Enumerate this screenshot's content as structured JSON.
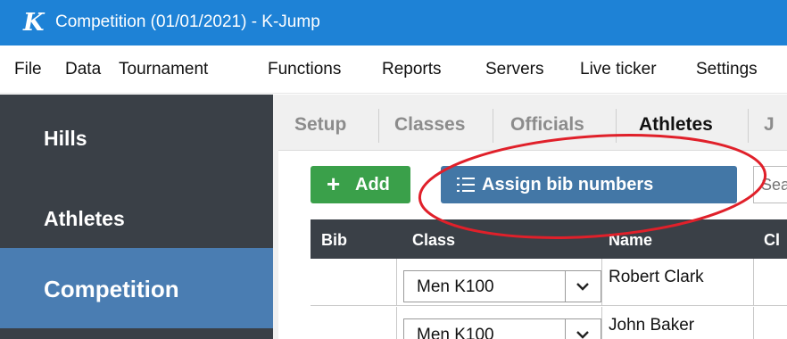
{
  "window": {
    "logo_letter": "K",
    "title": "Competition (01/01/2021) - K-Jump"
  },
  "menu": {
    "items": [
      "File",
      "Data",
      "Tournament",
      "Functions",
      "Reports",
      "Servers",
      "Live ticker",
      "Settings"
    ]
  },
  "sidebar": {
    "items": [
      {
        "label": "Hills",
        "selected": false
      },
      {
        "label": "Athletes",
        "selected": false
      },
      {
        "label": "Competition",
        "selected": true
      }
    ]
  },
  "tabs": {
    "items": [
      {
        "label": "Setup",
        "active": false
      },
      {
        "label": "Classes",
        "active": false
      },
      {
        "label": "Officials",
        "active": false
      },
      {
        "label": "Athletes",
        "active": true
      },
      {
        "label": "J",
        "active": false
      }
    ]
  },
  "toolbar": {
    "add_icon": "plus-icon",
    "add_label": "Add",
    "assign_icon": "list-icon",
    "assign_label": "Assign bib numbers",
    "search_placeholder": "Sea"
  },
  "table": {
    "columns": [
      "Bib",
      "Class",
      "Name",
      "Cl"
    ],
    "rows": [
      {
        "bib": "",
        "class": "Men K100",
        "name": "Robert Clark"
      },
      {
        "bib": "",
        "class": "Men K100",
        "name": "John Baker"
      }
    ]
  },
  "colors": {
    "titlebar": "#1e82d6",
    "sidebar": "#3a4047",
    "sidebar_selected": "#4a7db2",
    "add_button": "#3aa04a",
    "assign_button": "#4377a6",
    "highlight": "#e0202a"
  }
}
